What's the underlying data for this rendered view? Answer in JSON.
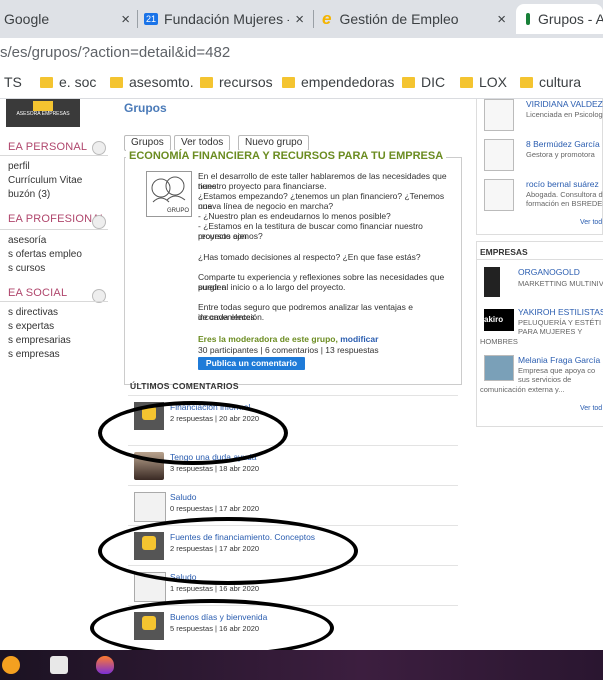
{
  "browser": {
    "tabs": [
      {
        "label": "Google",
        "close": "×"
      },
      {
        "label": "Fundación Mujeres - Calend",
        "close": "×",
        "badge": "21"
      },
      {
        "label": "Gestión de Empleo",
        "close": "×"
      },
      {
        "label": "Grupos - A",
        "close": ""
      }
    ],
    "url": "s/es/grupos/?action=detail&id=482",
    "bookmarks": [
      "TS",
      "e. soc",
      "asesomto.",
      "recursos",
      "empendedoras",
      "DIC",
      "LOX",
      "cultura"
    ]
  },
  "leftnav": {
    "logo_text": "ASESORA EMPRESAS",
    "sections": [
      {
        "title": "EA PERSONAL",
        "items": [
          "perfil",
          "Currículum Vitae",
          "buzón (3)"
        ]
      },
      {
        "title": "EA PROFESIONAL",
        "items": [
          "asesoría",
          "s ofertas empleo",
          "s cursos"
        ]
      },
      {
        "title": "EA SOCIAL",
        "items": [
          "s directivas",
          "s expertas",
          "s empresarias",
          "s empresas"
        ]
      }
    ]
  },
  "main": {
    "page_title": "Grupos",
    "buttons": {
      "grupos": "Grupos",
      "ver_todos": "Ver todos",
      "nuevo": "Nuevo grupo"
    },
    "group_title": "ECONOMÍA FINANCIERA Y RECURSOS PARA TU EMPRESA",
    "group_image_label": "GRUPO",
    "description": [
      "En el desarrollo de este taller hablaremos de las necesidades que tiene",
      "nuestro proyecto para financiarse.",
      "¿Estamos empezando? ¿tenemos un plan financiero? ¿Tenemos una",
      "nueva línea de negocio en marcha?",
      "- ¿Nuestro plan es endeudarnos lo menos posible?",
      "- ¿Estamos en la testitura de buscar como financiar nuestro proyecto con",
      "recursos ajenos?",
      "¿Has tomado decisiones al respecto? ¿En que fase estás?",
      "Comparte tu experiencia y reflexiones sobre las necesidades que pueden",
      "surgir al inicio o a lo largo del proyecto.",
      "Entre todas seguro que podremos analizar las ventajas e inconvenientes",
      "de cada elección."
    ],
    "moderator_text": "Eres la moderadora de este grupo, ",
    "moderator_link": "modificar",
    "stats": "30 participantes | 6 comentarios | 13 respuestas",
    "publish_button": "Publica un comentario",
    "comments_header": "ÚLTIMOS COMENTARIOS",
    "comments": [
      {
        "title": "Financiación informal",
        "meta": "2 respuestas | 20 abr 2020",
        "icon": "logo"
      },
      {
        "title": "Tengo una duda ayuda",
        "meta": "3 respuestas | 18 abr 2020",
        "icon": "photo"
      },
      {
        "title": "Saludo",
        "meta": "0 respuestas | 17 abr 2020",
        "icon": "sketch"
      },
      {
        "title": "Fuentes de financiamiento. Conceptos",
        "meta": "2 respuestas | 17 abr 2020",
        "icon": "logo"
      },
      {
        "title": "Saludo",
        "meta": "1 respuestas | 16 abr 2020",
        "icon": "sketch"
      },
      {
        "title": "Buenos días y bienvenida",
        "meta": "5 respuestas | 16 abr 2020",
        "icon": "logo"
      }
    ]
  },
  "right": {
    "people": [
      {
        "name": "VIRIDIANA VALDEZ",
        "sub": "Licenciada en Psicologí"
      },
      {
        "name": "8 Bermúdez García",
        "sub": "Gestora y promotora"
      },
      {
        "name": "rocío bernal suárez",
        "sub": "Abogada. Consultora de",
        "sub2": "formación en BSREDES"
      }
    ],
    "ver_todas": "Ver tod",
    "empresas_title": "EMPRESAS",
    "empresas": [
      {
        "name": "ORGANOGOLD",
        "sub": "MARKETTING MULTINIV"
      },
      {
        "name": "YAKIROH ESTILISTAS",
        "sub": "PELUQUERÍA Y ESTÉTI",
        "sub2": "PARA MUJERES Y",
        "sub3": "HOMBRES",
        "logo": "akiro"
      },
      {
        "name": "Melania Fraga García",
        "sub": "Empresa que apoya co",
        "sub2": "sus servicios de",
        "sub3": "comunicación externa y..."
      }
    ],
    "ver_todas2": "Ver tod"
  }
}
